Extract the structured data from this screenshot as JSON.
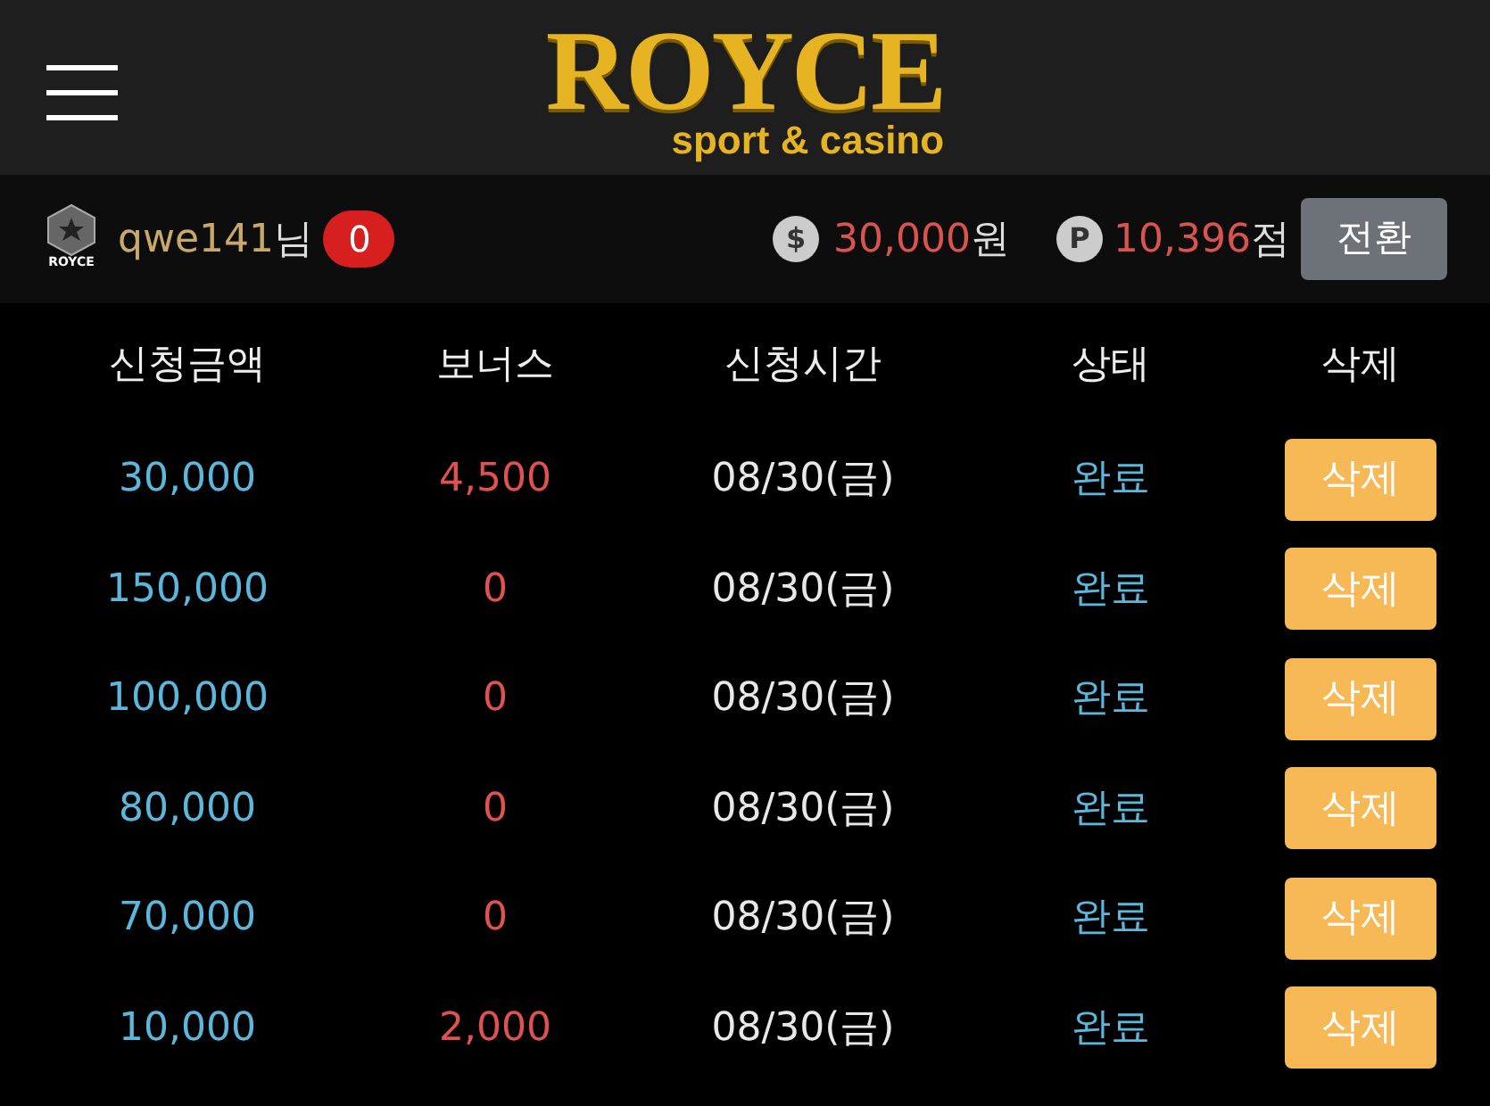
{
  "header": {
    "logo_title": "ROYCE",
    "logo_subtitle": "sport & casino"
  },
  "user_bar": {
    "avatar_label": "ROYCE",
    "username": "qwe141",
    "suffix": "님",
    "notifications": "0",
    "money": {
      "symbol": "$",
      "amount": "30,000",
      "unit": "원"
    },
    "points": {
      "symbol": "P",
      "amount": "10,396",
      "unit": "점"
    },
    "convert_button": "전환"
  },
  "table": {
    "columns": [
      "신청금액",
      "보너스",
      "신청시간",
      "상태",
      "삭제"
    ],
    "rows": [
      {
        "amount": "30,000",
        "bonus": "4,500",
        "time": "08/30(금)",
        "status": "완료",
        "action": "삭제"
      },
      {
        "amount": "150,000",
        "bonus": "0",
        "time": "08/30(금)",
        "status": "완료",
        "action": "삭제"
      },
      {
        "amount": "100,000",
        "bonus": "0",
        "time": "08/30(금)",
        "status": "완료",
        "action": "삭제"
      },
      {
        "amount": "80,000",
        "bonus": "0",
        "time": "08/30(금)",
        "status": "완료",
        "action": "삭제"
      },
      {
        "amount": "70,000",
        "bonus": "0",
        "time": "08/30(금)",
        "status": "완료",
        "action": "삭제"
      },
      {
        "amount": "10,000",
        "bonus": "2,000",
        "time": "08/30(금)",
        "status": "완료",
        "action": "삭제"
      }
    ]
  }
}
